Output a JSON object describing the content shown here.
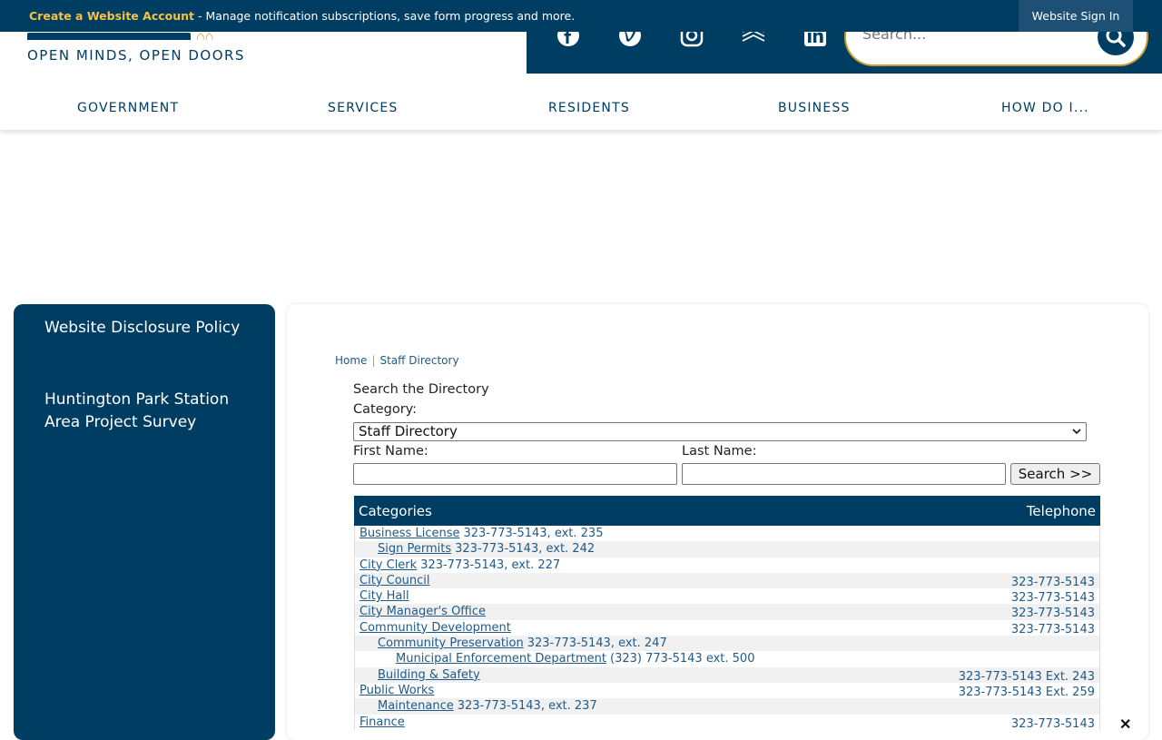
{
  "topbar": {
    "create_link": "Create a Website Account",
    "message": " - Manage notification subscriptions, save form progress and more.",
    "sign_in": "Website Sign In"
  },
  "logo": {
    "tagline": "OPEN MINDS, OPEN DOORS"
  },
  "social": [
    "facebook-icon",
    "vimeo-icon",
    "instagram-icon",
    "nextdoor-icon",
    "linkedin-icon"
  ],
  "search": {
    "placeholder": "Search..."
  },
  "nav": [
    "GOVERNMENT",
    "SERVICES",
    "RESIDENTS",
    "BUSINESS",
    "HOW DO I..."
  ],
  "sidebar": {
    "links": [
      "Website Disclosure Policy",
      "Huntington Park Station Area Project Survey"
    ]
  },
  "breadcrumb": {
    "home": "Home",
    "current": "Staff Directory"
  },
  "form": {
    "heading": "Search the Directory",
    "category_label": "Category:",
    "category_value": "Staff Directory",
    "first_name_label": "First Name:",
    "last_name_label": "Last Name:",
    "search_button": "Search >>"
  },
  "table": {
    "headers": {
      "categories": "Categories",
      "telephone": "Telephone"
    },
    "rows": [
      {
        "name": "Business License",
        "inline_phone": "323-773-5143, ext. 235",
        "right_phone": "",
        "indent": 0
      },
      {
        "name": "Sign Permits",
        "inline_phone": "323-773-5143, ext. 242",
        "right_phone": "",
        "indent": 1
      },
      {
        "name": "City Clerk",
        "inline_phone": "323-773-5143, ext. 227",
        "right_phone": "",
        "indent": 0
      },
      {
        "name": "City Council",
        "inline_phone": "",
        "right_phone": "323-773-5143",
        "indent": 0
      },
      {
        "name": "City Hall",
        "inline_phone": "",
        "right_phone": "323-773-5143",
        "indent": 0
      },
      {
        "name": "City Manager's Office",
        "inline_phone": "",
        "right_phone": "323-773-5143",
        "indent": 0
      },
      {
        "name": "Community Development",
        "inline_phone": "",
        "right_phone": "323-773-5143",
        "indent": 0
      },
      {
        "name": "Community Preservation",
        "inline_phone": "323-773-5143, ext. 247",
        "right_phone": "",
        "indent": 1
      },
      {
        "name": "Municipal Enforcement Department",
        "inline_phone": "(323) 773-5143 ext. 500",
        "right_phone": "",
        "indent": 2
      },
      {
        "name": "Building & Safety",
        "inline_phone": "",
        "right_phone": "323-773-5143 Ext. 243",
        "indent": 1
      },
      {
        "name": "Public Works",
        "inline_phone": "",
        "right_phone": "323-773-5143 Ext. 259",
        "indent": 0
      },
      {
        "name": "Maintenance",
        "inline_phone": "323-773-5143, ext. 237",
        "right_phone": "",
        "indent": 1
      },
      {
        "name": "Finance",
        "inline_phone": "",
        "right_phone": "323-773-5143",
        "indent": 0
      }
    ]
  },
  "close": "✕"
}
